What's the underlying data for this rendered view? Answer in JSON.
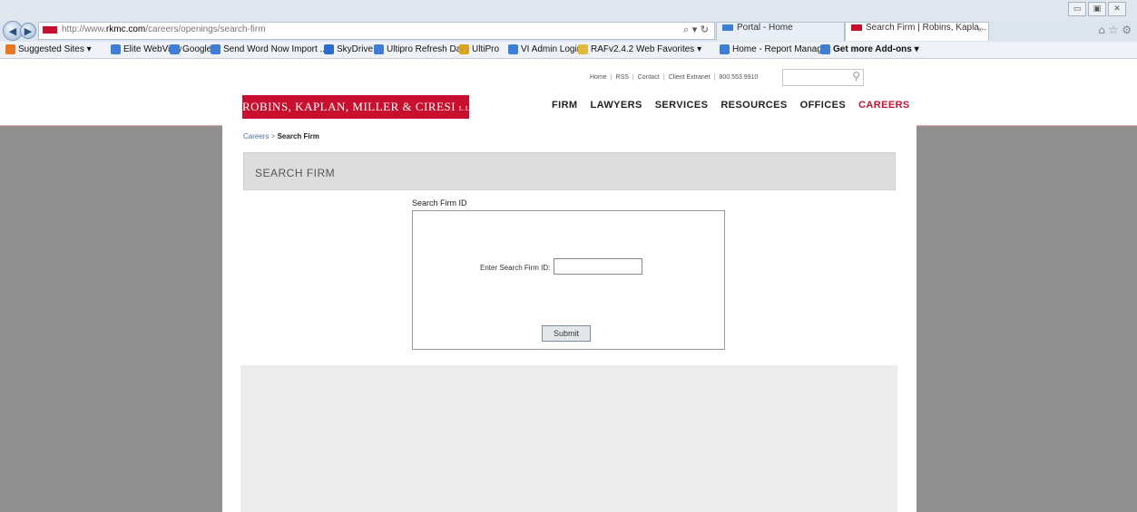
{
  "browser": {
    "url_prefix": "http://www.",
    "url_domain": "rkmc.com",
    "url_path": "/careers/openings/search-firm",
    "address_tools": "⌕ ▾ ↻",
    "tabs": [
      {
        "label": "Portal - Home",
        "active": false
      },
      {
        "label": "Search Firm | Robins, Kapla...",
        "active": true
      }
    ],
    "tab_close": "×",
    "window_controls": [
      "▭",
      "▣",
      "✕"
    ]
  },
  "favorites": [
    {
      "label": "Suggested Sites ▾",
      "icon": "suggested-sites-icon",
      "color": "#e87722"
    },
    {
      "label": "Elite WebView",
      "icon": "ie-page-icon",
      "color": "#3f7ed6"
    },
    {
      "label": "Google",
      "icon": "ie-page-icon",
      "color": "#3f7ed6"
    },
    {
      "label": "Send Word Now Import ...",
      "icon": "ie-page-icon",
      "color": "#3f7ed6"
    },
    {
      "label": "SkyDrive",
      "icon": "skydrive-icon",
      "color": "#2c6bd1"
    },
    {
      "label": "Ultipro Refresh Data",
      "icon": "ie-page-icon",
      "color": "#3f7ed6"
    },
    {
      "label": "UltiPro",
      "icon": "ultipro-icon",
      "color": "#d9a520"
    },
    {
      "label": "VI Admin Login",
      "icon": "ie-page-icon",
      "color": "#3f7ed6"
    },
    {
      "label": "RAFv2.4.2 Web Favorites ▾",
      "icon": "folder-icon",
      "color": "#e2b93b"
    },
    {
      "label": "Home - Report Manager",
      "icon": "ie-page-icon",
      "color": "#3f7ed6"
    },
    {
      "label": "Get more Add-ons ▾",
      "icon": "ie-page-icon",
      "color": "#3f7ed6"
    }
  ],
  "site": {
    "utility_links": [
      "Home",
      "RSS",
      "Contact",
      "Client Extranet",
      "800.553.9910"
    ],
    "utility_separator": "|",
    "logo_text": "ROBINS, KAPLAN, MILLER & CIRESI",
    "logo_suffix": "L.L.P.",
    "nav": [
      "FIRM",
      "LAWYERS",
      "SERVICES",
      "RESOURCES",
      "OFFICES",
      "CAREERS"
    ],
    "nav_current": "CAREERS",
    "brand_color": "#c8102e"
  },
  "breadcrumb": {
    "parent": "Careers",
    "separator": ">",
    "current": "Search Firm"
  },
  "page_title": "SEARCH FIRM",
  "form": {
    "legend": "Search Firm ID",
    "field_label": "Enter Search Firm ID:",
    "field_value": "",
    "submit_label": "Submit"
  }
}
